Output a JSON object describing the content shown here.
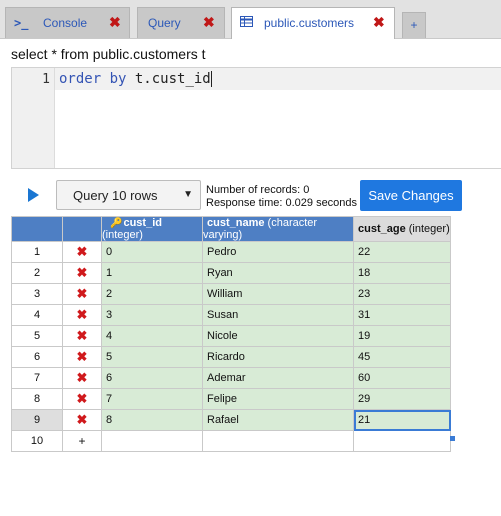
{
  "tabs": [
    {
      "label": "Console",
      "icon": "terminal-icon",
      "active": false
    },
    {
      "label": "Query",
      "icon": "",
      "active": false
    },
    {
      "label": "public.customers",
      "icon": "table-icon",
      "active": true
    }
  ],
  "add_tab_label": "+",
  "sql_header": "select * from public.customers t",
  "editor": {
    "line_number": "1",
    "keyword1": "order",
    "keyword2": "by",
    "text": " t.cust_id"
  },
  "toolbar": {
    "query_select": "Query 10 rows",
    "records_label": "Number of records: 0",
    "response_label": "Response time: 0.029 seconds",
    "save_label": "Save Changes"
  },
  "grid": {
    "columns": [
      {
        "name": "cust_id",
        "type": "(integer)"
      },
      {
        "name": "cust_name",
        "type": "(character varying)"
      },
      {
        "name": "cust_age",
        "type": "(integer)"
      }
    ],
    "rows": [
      {
        "num": "1",
        "cust_id": "0",
        "cust_name": "Pedro",
        "cust_age": "22"
      },
      {
        "num": "2",
        "cust_id": "1",
        "cust_name": "Ryan",
        "cust_age": "18"
      },
      {
        "num": "3",
        "cust_id": "2",
        "cust_name": "William",
        "cust_age": "23"
      },
      {
        "num": "4",
        "cust_id": "3",
        "cust_name": "Susan",
        "cust_age": "31"
      },
      {
        "num": "5",
        "cust_id": "4",
        "cust_name": "Nicole",
        "cust_age": "19"
      },
      {
        "num": "6",
        "cust_id": "5",
        "cust_name": "Ricardo",
        "cust_age": "45"
      },
      {
        "num": "7",
        "cust_id": "6",
        "cust_name": "Ademar",
        "cust_age": "60"
      },
      {
        "num": "8",
        "cust_id": "7",
        "cust_name": "Felipe",
        "cust_age": "29"
      },
      {
        "num": "9",
        "cust_id": "8",
        "cust_name": "Rafael",
        "cust_age": "21"
      }
    ],
    "new_row_num": "10",
    "add_label": "+",
    "delete_glyph": "✖"
  },
  "colors": {
    "accent": "#1f78e0",
    "header": "#4e7fc4",
    "row": "#d8ebd6",
    "delete": "#d0191c"
  }
}
